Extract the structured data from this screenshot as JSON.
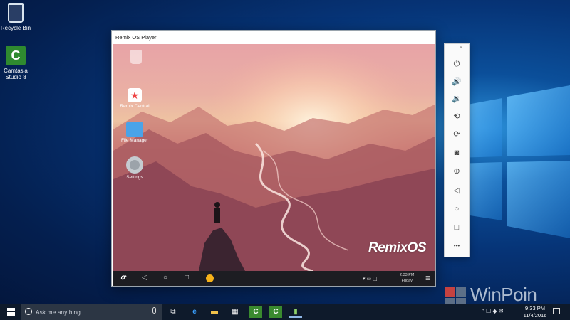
{
  "desktop": {
    "icons": [
      {
        "label": "Recycle Bin",
        "icon": "recycle-bin-icon"
      },
      {
        "label": "Camtasia Studio 8",
        "icon": "camtasia-icon"
      }
    ]
  },
  "player": {
    "title": "Remix OS Player",
    "apps": [
      {
        "label": "",
        "icon": "trash-icon"
      },
      {
        "label": "Remix Central",
        "icon": "star-app-icon"
      },
      {
        "label": "File Manager",
        "icon": "folder-icon"
      },
      {
        "label": "Settings",
        "icon": "gear-icon"
      }
    ],
    "brand": "RemixOS",
    "navbar": {
      "home_glyph": "ꝍ",
      "back": "◁",
      "home": "○",
      "recents": "□",
      "tray": "▾  ▭  ◫",
      "clock_time": "2:33 PM",
      "clock_day": "Friday",
      "menu": "☰",
      "accent": "#f6b21a"
    }
  },
  "toolbar": {
    "minimize": "–",
    "close": "×",
    "buttons": [
      {
        "name": "power-button",
        "glyph": "⏻"
      },
      {
        "name": "volume-up-button",
        "glyph": "🔊"
      },
      {
        "name": "volume-down-button",
        "glyph": "🔉"
      },
      {
        "name": "rotate-button",
        "glyph": "⟲"
      },
      {
        "name": "rotate-alt-button",
        "glyph": "⟳"
      },
      {
        "name": "screenshot-button",
        "glyph": "◙"
      },
      {
        "name": "zoom-button",
        "glyph": "⊕"
      },
      {
        "name": "back-button",
        "glyph": "◁"
      },
      {
        "name": "home-button",
        "glyph": "○"
      },
      {
        "name": "recents-button",
        "glyph": "□"
      },
      {
        "name": "more-button",
        "glyph": "•••"
      }
    ]
  },
  "taskbar": {
    "search_placeholder": "Ask me anything",
    "apps": [
      {
        "name": "task-view",
        "glyph": "⧉",
        "active": false
      },
      {
        "name": "edge",
        "glyph": "e",
        "active": false
      },
      {
        "name": "file-explorer",
        "glyph": "▬",
        "active": false
      },
      {
        "name": "store",
        "glyph": "▦",
        "active": false
      },
      {
        "name": "camtasia-recorder",
        "glyph": "C",
        "active": false
      },
      {
        "name": "camtasia-studio",
        "glyph": "C",
        "active": false
      },
      {
        "name": "remix-os-player",
        "glyph": "▮",
        "active": true
      }
    ],
    "tray": "^  ☐  ◆  ✉",
    "time": "9:33 PM",
    "date": "11/4/2016"
  },
  "watermark": "WinPoin"
}
